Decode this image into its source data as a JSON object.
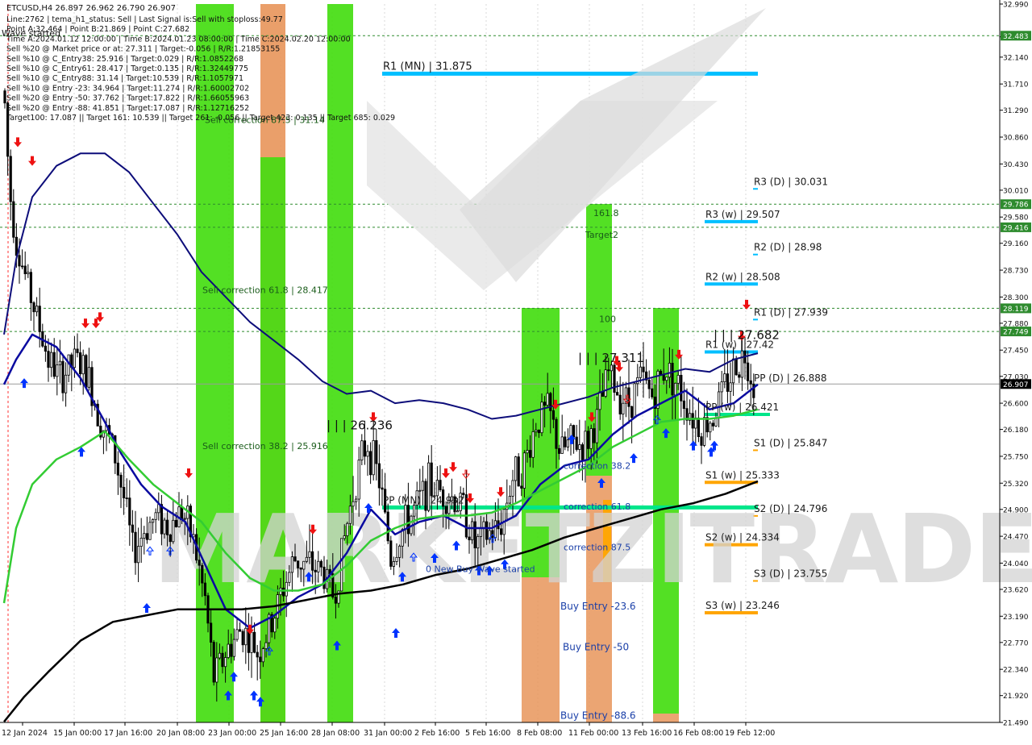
{
  "chart_data": {
    "type": "candlestick",
    "symbol_line": "ETCUSD,H4  26.897 26.962 26.790 26.907",
    "info_lines": [
      "Line:2762 | tema_h1_status: Sell | Last Signal is:Sell with stoploss:49.77",
      "Point A:32.464 | Point B:21.869 | Point C:27.682",
      "Time A:2024.01.12 12:00:00 | Time B:2024.01.23 08:00:00 | Time C:2024.02.20 12:00:00",
      "Sell %20 @ Market price or at: 27.311 | Target:-0.056 | R/R:1.21853155",
      "Sell %10 @ C_Entry38: 25.916 | Target:0.029 | R/R:1.0852268",
      "Sell %10 @ C_Entry61: 28.417 | Target:0.135 | R/R:1.32449775",
      "Sell %10 @ C_Entry88: 31.14 | Target:10.539 | R/R:1.1057971",
      "Sell %10 @ Entry -23: 34.964 | Target:11.274 | R/R:1.60002702",
      "Sell %20 @ Entry -50: 37.762 | Target:17.822 | R/R:1.66055963",
      "Sell %20 @ Entry -88: 41.851 | Target:17.087 | R/R:1.12716252",
      "Target100: 17.087 || Target 161: 10.539 || Target 261: -0.056 || Target 423: 0.135 || Target 685: 0.029"
    ],
    "wave_started_label": "Wave started",
    "y_ticks": [
      "32.990",
      "32.465",
      "32.140",
      "31.710",
      "31.290",
      "30.860",
      "30.430",
      "30.010",
      "29.580",
      "29.160",
      "28.730",
      "28.300",
      "27.880",
      "27.450",
      "27.030",
      "26.600",
      "26.180",
      "25.750",
      "25.320",
      "24.900",
      "24.470",
      "24.040",
      "23.620",
      "23.190",
      "22.770",
      "22.340",
      "21.920",
      "21.490"
    ],
    "y_range": [
      21.49,
      32.99
    ],
    "x_ticks": [
      "12 Jan 2024",
      "15 Jan 00:00",
      "17 Jan 16:00",
      "20 Jan 08:00",
      "23 Jan 00:00",
      "25 Jan 16:00",
      "28 Jan 08:00",
      "31 Jan 00:00",
      "2 Feb 16:00",
      "5 Feb 16:00",
      "8 Feb 08:00",
      "11 Feb 00:00",
      "13 Feb 16:00",
      "16 Feb 08:00",
      "19 Feb 12:00"
    ],
    "price_badges": [
      {
        "value": "32.483",
        "color": "#2e8b2e"
      },
      {
        "value": "29.786",
        "color": "#2e8b2e"
      },
      {
        "value": "29.416",
        "color": "#2e8b2e"
      },
      {
        "value": "28.119",
        "color": "#2e8b2e"
      },
      {
        "value": "27.749",
        "color": "#2e8b2e"
      },
      {
        "value": "26.907",
        "color": "#000000"
      }
    ],
    "pivot_levels": [
      {
        "label": "R1 (MN) | 31.875",
        "value": 31.875,
        "color": "#00bfff"
      },
      {
        "label": "R3 (D) | 30.031",
        "value": 30.031,
        "color": "#00bfff"
      },
      {
        "label": "R3 (w) | 29.507",
        "value": 29.507,
        "color": "#00bfff"
      },
      {
        "label": "R2 (D) | 28.98",
        "value": 28.98,
        "color": "#00bfff"
      },
      {
        "label": "R2 (w) | 28.508",
        "value": 28.508,
        "color": "#00bfff"
      },
      {
        "label": "R1 (D) | 27.939",
        "value": 27.939,
        "color": "#00bfff"
      },
      {
        "label": "R1 (w) | 27.42",
        "value": 27.42,
        "color": "#00bfff"
      },
      {
        "label": "PP (D) | 26.888",
        "value": 26.888,
        "color": "#00bfff"
      },
      {
        "label": "PP (w) | 26.421",
        "value": 26.421,
        "color": "#00e68a"
      },
      {
        "label": "S1 (D) | 25.847",
        "value": 25.847,
        "color": "#ffa500"
      },
      {
        "label": "S1 (w) | 25.333",
        "value": 25.333,
        "color": "#ffa500"
      },
      {
        "label": "S2 (D) | 24.796",
        "value": 24.796,
        "color": "#ffa500"
      },
      {
        "label": "S2 (w) | 24.334",
        "value": 24.334,
        "color": "#ffa500"
      },
      {
        "label": "S3 (D) | 23.755",
        "value": 23.755,
        "color": "#ffa500"
      },
      {
        "label": "S3 (w) | 23.246",
        "value": 23.246,
        "color": "#ffa500"
      },
      {
        "label": "PP (MN) | 24.932",
        "value": 24.932,
        "color": "#00e68a"
      }
    ],
    "annotations": [
      {
        "text": "Sell correction 87.5 | 31.14",
        "value": 31.14
      },
      {
        "text": "Sell correction 61.8 | 28.417",
        "value": 28.417
      },
      {
        "text": "Sell correction 38.2 | 25.916",
        "value": 25.916
      },
      {
        "text": "| | | 26.236",
        "value": 26.236
      },
      {
        "text": "| | | 27.311",
        "value": 27.311
      },
      {
        "text": "| | | 27.682",
        "value": 27.682
      },
      {
        "text": "161.8",
        "value": 29.65
      },
      {
        "text": "Target2",
        "value": 29.3
      },
      {
        "text": "100",
        "value": 27.95
      },
      {
        "text": "correction 38.2",
        "value": 25.6
      },
      {
        "text": "correction 61.8",
        "value": 24.95
      },
      {
        "text": "correction 87.5",
        "value": 24.3
      },
      {
        "text": "0 New Buy Wave started",
        "value": 23.95
      },
      {
        "text": "Buy Entry -23.6",
        "value": 23.35
      },
      {
        "text": "Buy Entry -50",
        "value": 22.7
      },
      {
        "text": "Buy Entry -88.6",
        "value": 21.6
      }
    ],
    "dotted_levels": [
      32.483,
      29.786,
      29.416,
      28.119,
      27.749
    ],
    "current_price": 26.907,
    "watermark": "MARKETZITRADE",
    "grid": true
  }
}
